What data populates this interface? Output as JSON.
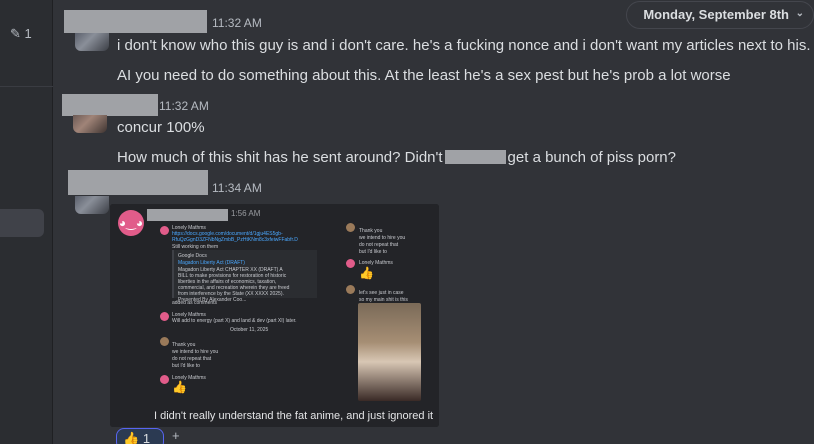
{
  "sidebar": {
    "edit_count": "1",
    "edit_icon": "pencil-icon"
  },
  "date_divider": {
    "label": "Monday, September 8th",
    "chevron": "›"
  },
  "messages": [
    {
      "timestamp": "11:32 AM",
      "lines": [
        "i don't know who this guy is and i don't care. he's a fucking nonce and i don't want my articles next to his.",
        "AI you need to do something about this. At the least he's a sex pest but he's prob a lot worse"
      ]
    },
    {
      "timestamp": "11:32 AM",
      "lines": [
        "concur 100%"
      ],
      "line2_before": "How much of this shit has he sent around? Didn't",
      "line2_after": "get a bunch of piss porn?"
    },
    {
      "timestamp": "11:34 AM"
    }
  ],
  "embed": {
    "timestamp": "1:56 AM",
    "caption": "I didn't really understand the fat anime, and just ignored it",
    "logo_label": "discord-logo",
    "mini": {
      "sender": "Lonely Mathms",
      "link": "https://docs.google.com/document/d/1gju4ES5gb-RfuQzGgnD3ZFNbNgZmbB_PzHtKNm8c3xfeiwFFabfr.D",
      "line_still": "Still working on them",
      "doc_source": "Google Docs",
      "doc_title": "Magadon Liberty Act (DRAFT)",
      "doc_desc": "Magadon Liberty Act CHAPTER XX (DRAFT) A BILL to make provisions for restoration of historic liberties in the affairs of economics, taxation, commercial, and recreation wherein they are freed from interference by the State (XX XXXX 2025). Presented By Alexander Coo...",
      "added": "added as comments",
      "will_add": "Will add to energy (part X) and land & dev (part XI) later.",
      "date_sep": "October 11, 2025",
      "thank_you": "Thank you",
      "intend": "we intend to hire you",
      "not_repeat": "do not repeat that",
      "but_like": "but I'd like to",
      "lets_see": "let's see just in case",
      "main_shit": "so my main shit is this"
    }
  },
  "reactions": [
    {
      "emoji": "👍",
      "count": "1"
    }
  ],
  "add_reaction_icon": "+"
}
